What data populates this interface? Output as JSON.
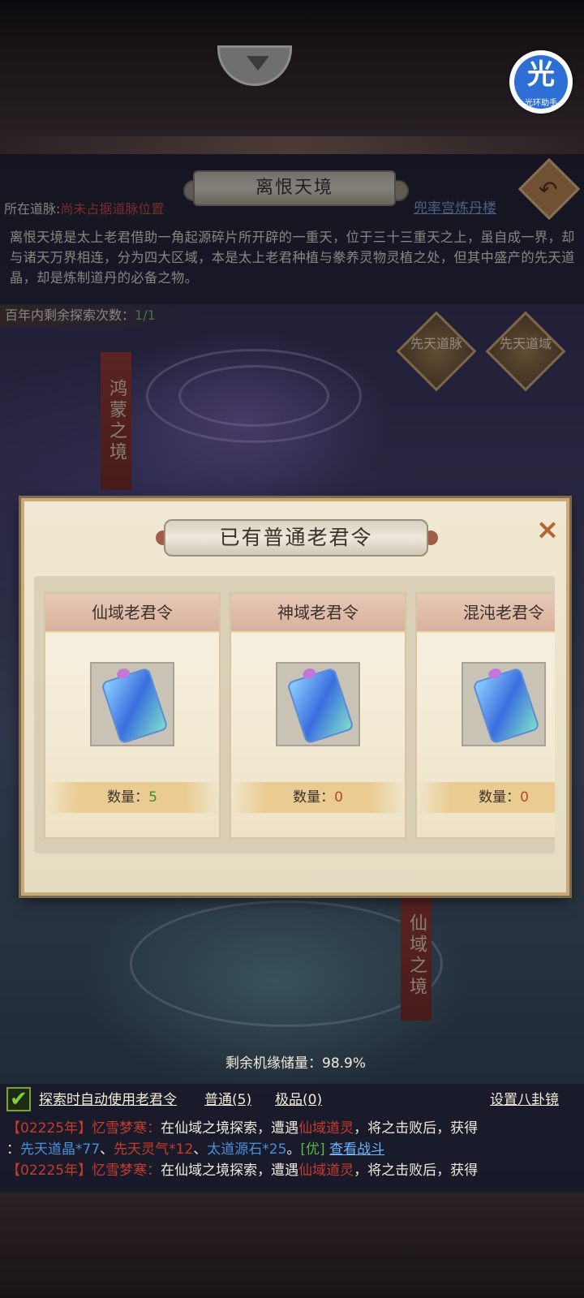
{
  "assistant": {
    "glyph": "光",
    "label": "光环助手"
  },
  "header": {
    "title": "离恨天境",
    "vein_label": "所在道脉:",
    "vein_value": "尚未占据道脉位置",
    "palace_link": "兜率宫炼丹楼",
    "description": "离恨天境是太上老君借助一角起源碎片所开辟的一重天，位于三十三重天之上，虽自成一界，却与诸天万界相连，分为四大区域，本是太上老君种植与豢养灵物灵植之处，但其中盛产的先天道晶，却是炼制道丹的必备之物。",
    "explore_label": "百年内剩余探索次数：",
    "explore_count": "1/1"
  },
  "side_buttons": [
    {
      "label": "先天道脉"
    },
    {
      "label": "先天道域"
    }
  ],
  "banners": {
    "top": "鸿蒙之境",
    "bottom": "仙域之境"
  },
  "modal": {
    "title": "已有普通老君令",
    "close": "×",
    "cards": [
      {
        "name": "仙域老君令",
        "qty_label": "数量：",
        "qty": "5"
      },
      {
        "name": "神域老君令",
        "qty_label": "数量：",
        "qty": "0"
      },
      {
        "name": "混沌老君令",
        "qty_label": "数量：",
        "qty": "0"
      }
    ]
  },
  "footer": {
    "reserve": "剩余机缘储量：98.9%",
    "auto_use": "探索时自动使用老君令",
    "normal": "普通(5)",
    "premium": "极品(0)",
    "bagua": "设置八卦镜",
    "checked": "✔"
  },
  "logs": [
    {
      "prefix": "【02225年】忆雪梦寒：",
      "text": "在仙域之境探索，遭遇",
      "enemy": "仙域道灵",
      "text2": "，将之击败后，获得"
    },
    {
      "prefix": "：",
      "item1": "先天道晶*77",
      "sep1": "、",
      "item2": "先天灵气*12",
      "sep2": "、",
      "item3": "太道源石*25",
      "end": "。",
      "tag": "[优]",
      "link": "查看战斗"
    },
    {
      "prefix": "【02225年】忆雪梦寒：",
      "text": "在仙域之境探索，遭遇",
      "enemy": "仙域道灵",
      "text2": "，将之击败后，获得"
    }
  ],
  "colors": {
    "accent": "#c8ab78",
    "red": "#c83a2e",
    "green": "#5ab84a",
    "link": "#7ea6e6"
  }
}
